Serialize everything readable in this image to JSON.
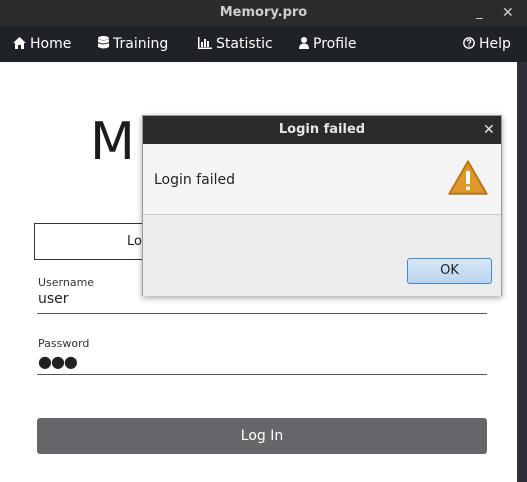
{
  "window": {
    "title": "Memory.pro",
    "minimize_glyph": "_",
    "close_glyph": "✕"
  },
  "menu": {
    "home": {
      "label": "Home",
      "icon": "home-icon"
    },
    "training": {
      "label": "Training",
      "icon": "database-icon"
    },
    "statistic": {
      "label": "Statistic",
      "icon": "bar-chart-icon"
    },
    "profile": {
      "label": "Profile",
      "icon": "user-icon"
    },
    "help": {
      "label": "Help",
      "icon": "question-circle-icon"
    }
  },
  "main": {
    "title_partial": "M",
    "tab_label_partial": "Lo",
    "username": {
      "label": "Username",
      "value": "user"
    },
    "password": {
      "label": "Password",
      "value": "●●●"
    },
    "login_button": "Log In"
  },
  "dialog": {
    "title": "Login failed",
    "message": "Login failed",
    "close_glyph": "✕",
    "ok_button": "OK",
    "icon": "warning-icon",
    "colors": {
      "warning": "#d18a1f",
      "ok_border": "#3d8fd1"
    }
  },
  "colors": {
    "titlebar": "#2b2b2b",
    "menubar": "#1f2226",
    "login_button": "#65676a"
  }
}
